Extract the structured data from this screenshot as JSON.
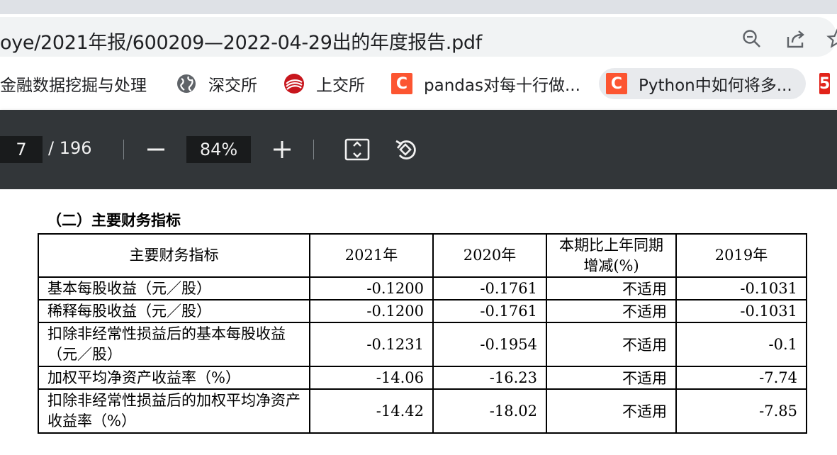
{
  "browser": {
    "url": "oye/2021年报/600209—2022-04-29出的年度报告.pdf",
    "icons": [
      "zoom-icon",
      "share-icon",
      "star-icon"
    ]
  },
  "bookmarks": [
    {
      "label": "金融数据挖掘与处理",
      "icon": ""
    },
    {
      "label": "深交所",
      "icon": "globe-icon"
    },
    {
      "label": "上交所",
      "icon": "sse-logo-icon"
    },
    {
      "label": "pandas对每十行做...",
      "icon": "csdn-icon",
      "icon_text": "C"
    },
    {
      "label": "Python中如何将多...",
      "icon": "csdn-icon",
      "icon_text": "C"
    },
    {
      "label": "",
      "icon": "51cto-icon",
      "icon_text": "5"
    }
  ],
  "pdf_toolbar": {
    "current_page": "7",
    "total_pages": "/ 196",
    "zoom": "84%",
    "icons": [
      "zoom-out-icon",
      "zoom-in-icon",
      "fit-page-icon",
      "rotate-icon"
    ]
  },
  "document": {
    "section_title": "（二）主要财务指标",
    "table": {
      "headers": [
        "主要财务指标",
        "2021年",
        "2020年",
        "本期比上年同期增减(%)",
        "2019年"
      ],
      "rows": [
        [
          "基本每股收益（元／股）",
          "-0.1200",
          "-0.1761",
          "不适用",
          "-0.1031"
        ],
        [
          "稀释每股收益（元／股）",
          "-0.1200",
          "-0.1761",
          "不适用",
          "-0.1031"
        ],
        [
          "扣除非经常性损益后的基本每股收益（元／股）",
          "-0.1231",
          "-0.1954",
          "不适用",
          "-0.1"
        ],
        [
          "加权平均净资产收益率（%）",
          "-14.06",
          "-16.23",
          "不适用",
          "-7.74"
        ],
        [
          "扣除非经常性损益后的加权平均净资产收益率（%）",
          "-14.42",
          "-18.02",
          "不适用",
          "-7.85"
        ]
      ]
    }
  },
  "colors": {
    "toolbar_bg": "#323639",
    "csdn_red": "#fc5531",
    "tab_strip": "#dee1e6"
  }
}
